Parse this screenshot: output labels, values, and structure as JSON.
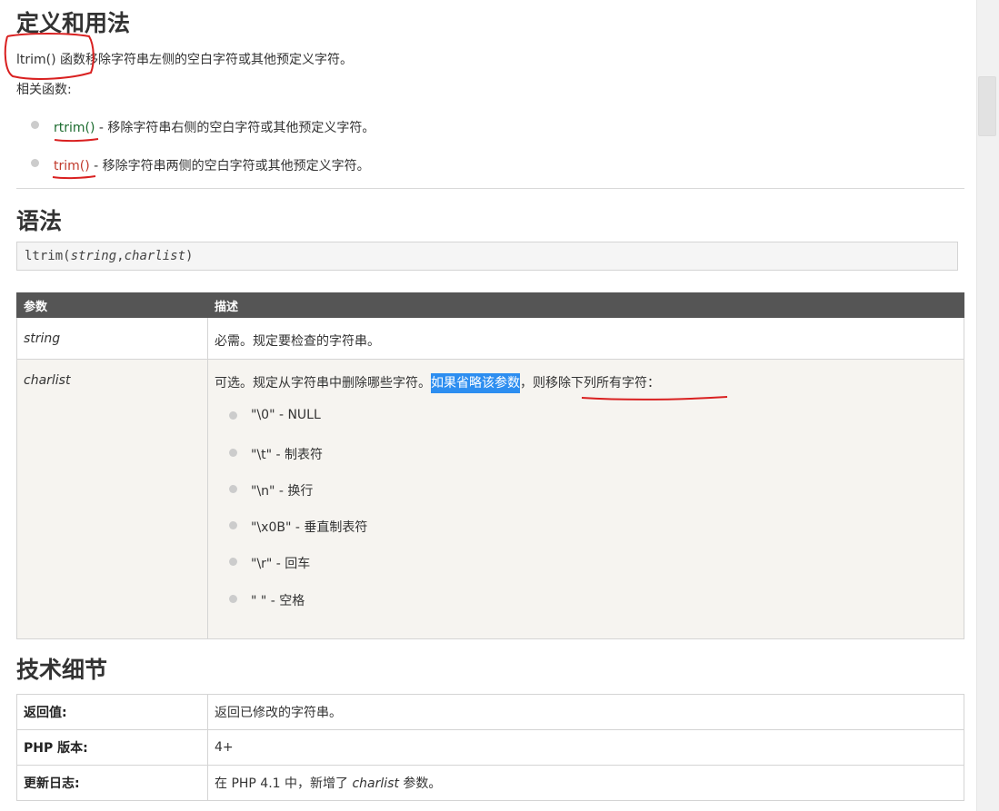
{
  "definition": {
    "heading": "定义和用法",
    "fn_name": "ltrim() 函数",
    "intro_rest": "移除字符串左侧的空白字符或其他预定义字符。",
    "related_label": "相关函数:",
    "related": [
      {
        "link": "rtrim()",
        "text": " - 移除字符串右侧的空白字符或其他预定义字符。"
      },
      {
        "link": "trim()",
        "text": " - 移除字符串两侧的空白字符或其他预定义字符。"
      }
    ]
  },
  "syntax": {
    "heading": "语法",
    "fn": "ltrim(",
    "arg1": "string",
    "comma": ",",
    "arg2": "charlist",
    "close": ")"
  },
  "params": {
    "headers": [
      "参数",
      "描述"
    ],
    "rows": [
      {
        "name": "string",
        "desc": "必需。规定要检查的字符串。"
      },
      {
        "name": "charlist",
        "desc_part1": "可选。规定从字符串中删除哪些字符。",
        "desc_highlight": "如果省略该参数",
        "desc_part2": "，则移除下列所有字符："
      }
    ],
    "chars": [
      "\"\\0\" - NULL",
      "\"\\t\" - 制表符",
      "\"\\n\" - 换行",
      "\"\\x0B\" - 垂直制表符",
      "\"\\r\" - 回车",
      "\" \" - 空格"
    ]
  },
  "tech": {
    "heading": "技术细节",
    "rows": [
      {
        "key": "返回值:",
        "value": "返回已修改的字符串。"
      },
      {
        "key": "PHP 版本:",
        "value": "4+"
      }
    ],
    "changelog_key": "更新日志:",
    "changelog_pre": "在 PHP 4.1 中，新增了 ",
    "changelog_arg": "charlist",
    "changelog_post": " 参数。"
  },
  "colors": {
    "annotation_red": "#d92020",
    "highlight": "#2d8ef0",
    "table_header": "#555555"
  }
}
